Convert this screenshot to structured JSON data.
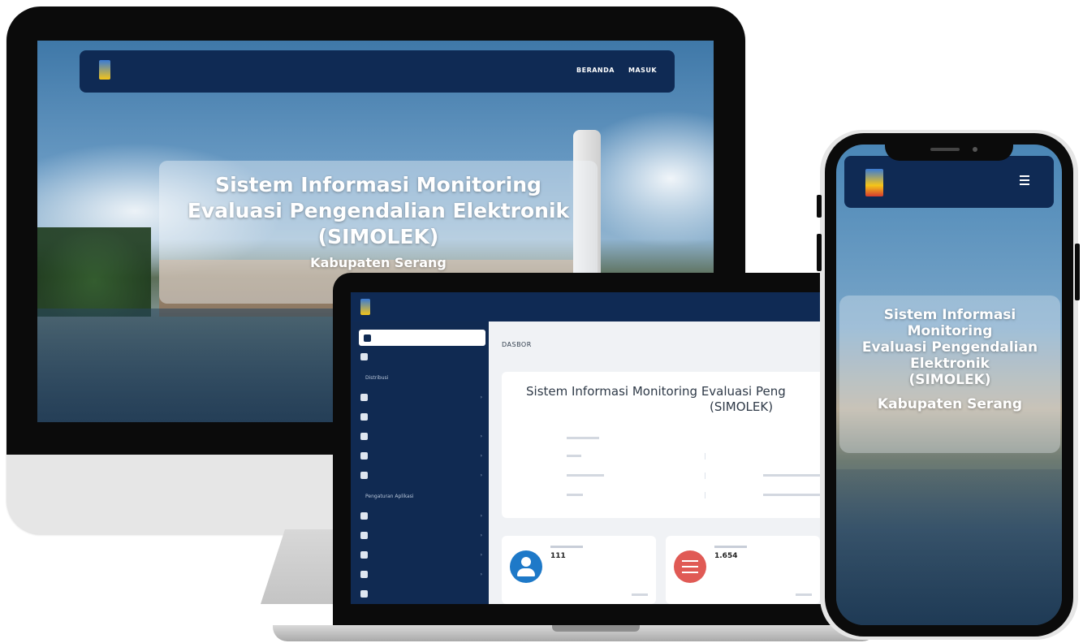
{
  "desktop": {
    "nav": {
      "links": [
        "BERANDA",
        "MASUK"
      ]
    },
    "hero": {
      "title_lines": [
        "Sistem Informasi Monitoring",
        "Evaluasi Pengendalian Elektronik",
        "(SIMOLEK)"
      ],
      "subtitle": "Kabupaten Serang"
    }
  },
  "laptop": {
    "breadcrumb": "",
    "page_title": "DASBOR",
    "sidebar": {
      "section_labels": [
        "Distribusi",
        "Pengaturan Aplikasi"
      ]
    },
    "card": {
      "title_line1": "Sistem Informasi Monitoring Evaluasi Peng",
      "title_line2": "(SIMOLEK)"
    },
    "stats": [
      {
        "value": "111",
        "color": "#1e79c8",
        "icon": "user-icon"
      },
      {
        "value": "1.654",
        "color": "#e05a55",
        "icon": "list-icon"
      }
    ]
  },
  "phone": {
    "hero": {
      "title_lines": [
        "Sistem Informasi",
        "Monitoring",
        "Evaluasi Pengendalian",
        "Elektronik",
        "(SIMOLEK)"
      ],
      "subtitle": "Kabupaten Serang"
    }
  },
  "colors": {
    "navy": "#0f2a54",
    "sidebar": "#102a52",
    "blue": "#1e79c8",
    "red": "#e05a55"
  }
}
